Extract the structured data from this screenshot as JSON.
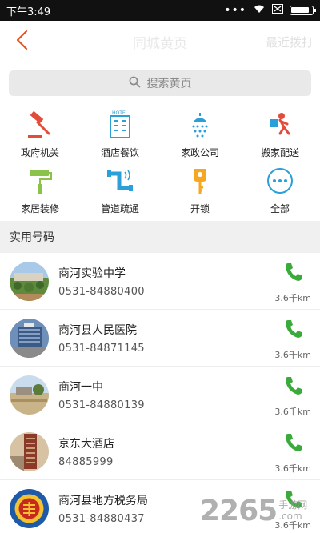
{
  "status_bar": {
    "time": "下午3:49",
    "battery_level": 0.9
  },
  "nav": {
    "title": "同城黄页",
    "recent_label": "最近拨打",
    "back_icon": "chevron-left-icon",
    "accent": "#e8541e"
  },
  "search": {
    "placeholder": "搜索黄页"
  },
  "categories": [
    {
      "label": "政府机关",
      "icon": "gavel-icon"
    },
    {
      "label": "酒店餐饮",
      "icon": "hotel-icon"
    },
    {
      "label": "家政公司",
      "icon": "shower-icon"
    },
    {
      "label": "搬家配送",
      "icon": "delivery-icon"
    },
    {
      "label": "家居装修",
      "icon": "paint-roller-icon"
    },
    {
      "label": "管道疏通",
      "icon": "pipe-icon"
    },
    {
      "label": "开锁",
      "icon": "key-icon"
    },
    {
      "label": "全部",
      "icon": "more-icon"
    }
  ],
  "section": {
    "title": "实用号码"
  },
  "contacts": [
    {
      "name": "商河实验中学",
      "phone": "0531-84880400",
      "distance": "3.6千km",
      "avatar": "school-photo"
    },
    {
      "name": "商河县人民医院",
      "phone": "0531-84871145",
      "distance": "3.6千km",
      "avatar": "hospital-photo"
    },
    {
      "name": "商河一中",
      "phone": "0531-84880139",
      "distance": "3.6千km",
      "avatar": "campus-photo"
    },
    {
      "name": "京东大酒店",
      "phone": "84885999",
      "distance": "3.6千km",
      "avatar": "hotel-photo"
    },
    {
      "name": "商河县地方税务局",
      "phone": "0531-84880437",
      "distance": "3.6千km",
      "avatar": "tax-emblem"
    }
  ],
  "watermark": {
    "number": "2265",
    "suffix": ".com",
    "site": "手游网"
  },
  "colors": {
    "call_green": "#3aab3a",
    "icon_blue": "#2a9fd8",
    "icon_red": "#e34b3a"
  }
}
